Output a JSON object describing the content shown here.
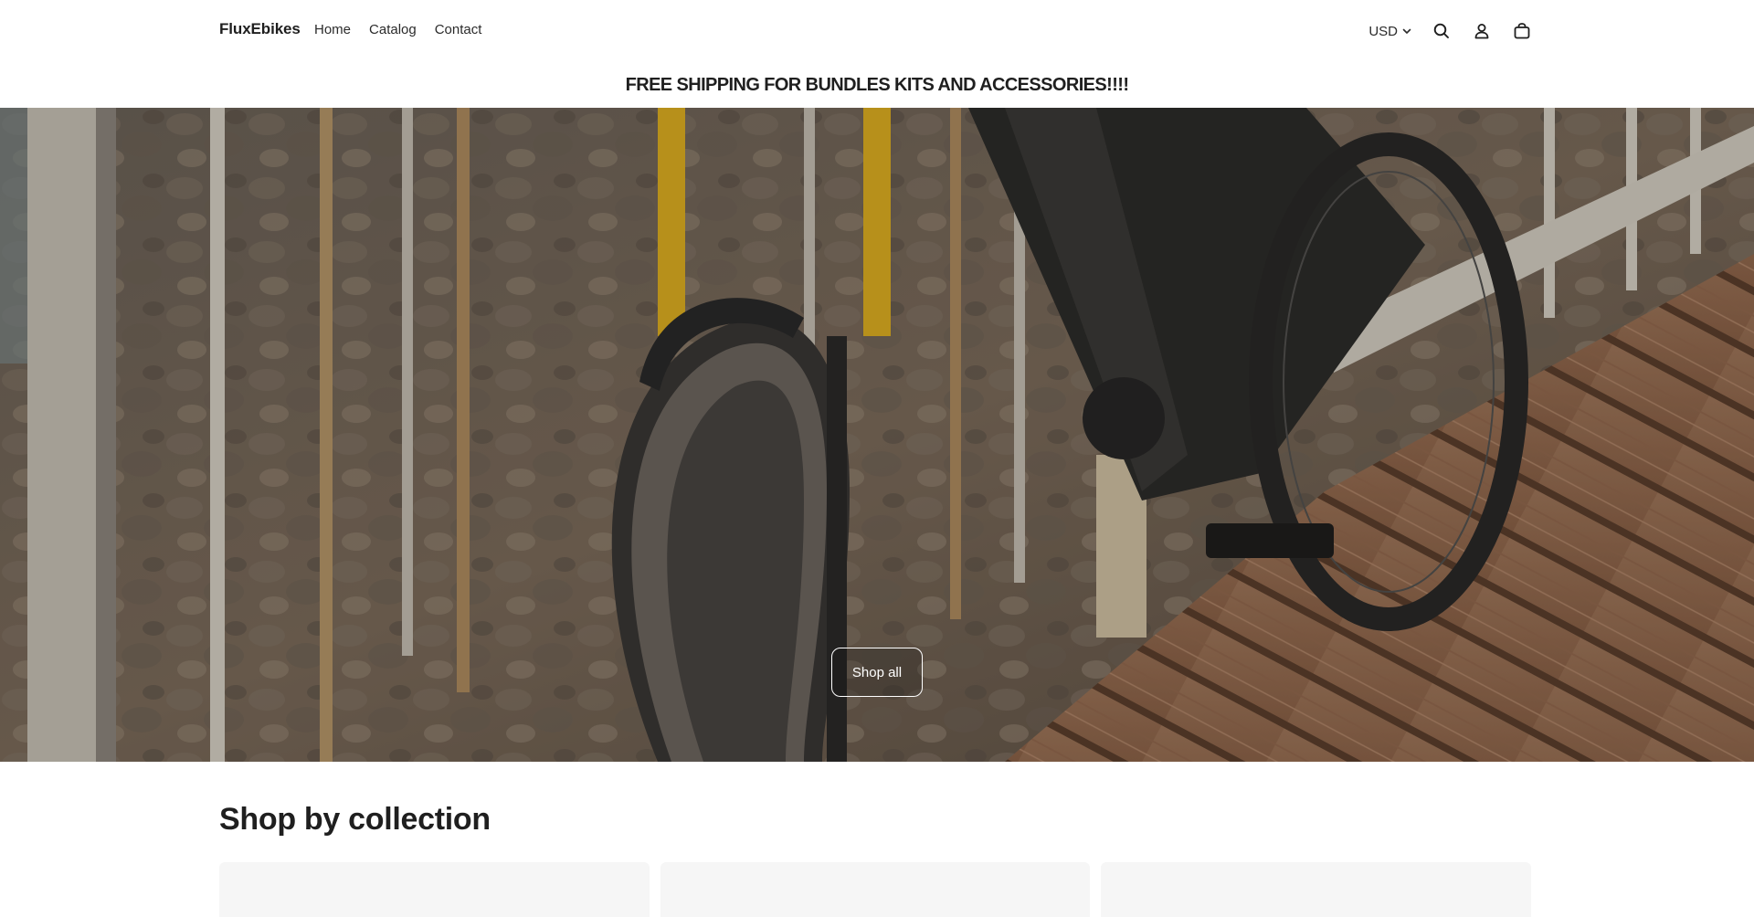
{
  "header": {
    "brand": "FluxEbikes",
    "nav": [
      {
        "label": "Home"
      },
      {
        "label": "Catalog"
      },
      {
        "label": "Contact"
      }
    ],
    "currency": "USD",
    "icons": [
      "search-icon",
      "account-icon",
      "cart-icon",
      "chevron-down-icon"
    ]
  },
  "announcement": {
    "text": "FREE SHIPPING FOR BUNDLES KITS AND ACCESSORIES!!!!"
  },
  "hero": {
    "button_label": "Shop all"
  },
  "collections": {
    "title": "Shop by collection"
  },
  "colors": {
    "text": "#1f1f1f",
    "background": "#ffffff",
    "card": "#f6f6f6"
  }
}
